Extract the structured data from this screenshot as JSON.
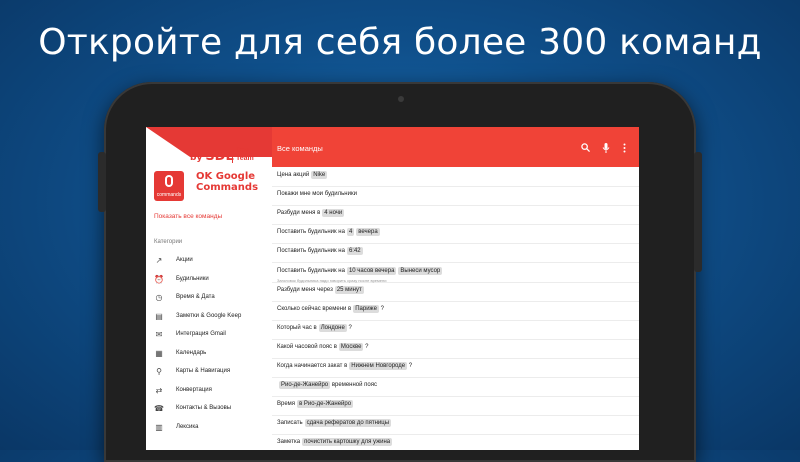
{
  "headline": "Откройте для себя более 300 команд",
  "app": {
    "brand_by": "by",
    "brand_sde": "SDE",
    "brand_devteam_1": "Dev",
    "brand_devteam_2": "Team",
    "icon_caption": "commands",
    "name_line1": "OK Google",
    "name_line2": "Commands",
    "show_all": "Показать все команды",
    "categories_label": "Категории"
  },
  "categories": [
    {
      "label": "Акции",
      "icon": "trending-up-icon"
    },
    {
      "label": "Будильники",
      "icon": "alarm-icon"
    },
    {
      "label": "Время & Дата",
      "icon": "clock-icon"
    },
    {
      "label": "Заметки & Google Keep",
      "icon": "note-icon"
    },
    {
      "label": "Интеграция Gmail",
      "icon": "mail-icon"
    },
    {
      "label": "Календарь",
      "icon": "calendar-icon"
    },
    {
      "label": "Карты & Навигация",
      "icon": "map-pin-icon"
    },
    {
      "label": "Конвертация",
      "icon": "convert-icon"
    },
    {
      "label": "Контакты & Вызовы",
      "icon": "contacts-icon"
    },
    {
      "label": "Лексика",
      "icon": "book-icon"
    }
  ],
  "toolbar": {
    "title": "Все команды"
  },
  "commands": [
    {
      "text": "Цена акций",
      "chip": "Nike",
      "after": ""
    },
    {
      "text": "Покажи мне мои будильники",
      "chip": "",
      "after": ""
    },
    {
      "text": "Разбуди меня в",
      "chip": "4 ночи",
      "after": ""
    },
    {
      "text": "Поставить будильник на",
      "chip": "4",
      "chip2": "вечера",
      "after": ""
    },
    {
      "text": "Поставить будильник на",
      "chip": "6:42",
      "after": ""
    },
    {
      "text": "Поставить будильник на",
      "chip": "10 часов вечера",
      "chip2": "Вынеси мусор",
      "after": "",
      "sub": "Заголовок будильника надо говорить сразу после времени"
    },
    {
      "text": "Разбуди меня через",
      "chip": "25 минут",
      "after": ""
    },
    {
      "text": "Сколько сейчас времени в",
      "chip": "Париже",
      "after": "?"
    },
    {
      "text": "Который час в",
      "chip": "Лондоне",
      "after": "?"
    },
    {
      "text": "Какой часовой пояс в",
      "chip": "Москве",
      "after": "?"
    },
    {
      "text": "Когда начинается закат в",
      "chip": "Нижнем Новгороде",
      "after": "?"
    },
    {
      "text": "",
      "chip": "Рио-де-Жанейро",
      "after": "временной пояс"
    },
    {
      "text": "Время",
      "chip": "в Рио-де-Жанейро",
      "after": ""
    },
    {
      "text": "Записать",
      "chip": "сдача рефератов до пятницы",
      "after": ""
    },
    {
      "text": "Заметка",
      "chip": "почистить картошку для ужина",
      "after": ""
    }
  ]
}
